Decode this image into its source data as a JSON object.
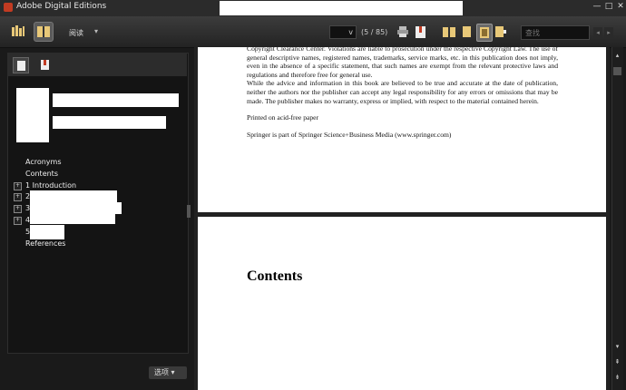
{
  "window": {
    "title": "Adobe Digital Editions",
    "minimize": "—",
    "maximize": "□",
    "close": "✕"
  },
  "toolbar": {
    "library_icon": "books-icon",
    "reading_icon": "open-book-icon",
    "read_label": "阅读",
    "read_caret": "▾",
    "page_select_value": "v",
    "page_count": "(5 / 85)",
    "search_placeholder": "查找",
    "prev": "◂",
    "next": "▸"
  },
  "left_panel": {
    "toc": [
      {
        "label": "Acronyms",
        "expandable": false
      },
      {
        "label": "Contents",
        "expandable": false
      },
      {
        "label": "1 Introduction",
        "expandable": true
      },
      {
        "label": "2",
        "expandable": true
      },
      {
        "label": "3",
        "expandable": true
      },
      {
        "label": "4",
        "expandable": true
      },
      {
        "label": "5",
        "expandable": false
      },
      {
        "label": "References",
        "expandable": false
      }
    ],
    "options_label": "选项 ▾"
  },
  "page1": {
    "para1": "Copyright Clearance Center. Violations are liable to prosecution under the respective Copyright Law. The use of general descriptive names, registered names, trademarks, service marks, etc. in this publication does not imply, even in the absence of a specific statement, that such names are exempt from the relevant protective laws and regulations and therefore free for general use.",
    "para2": "While the advice and information in this book are believed to be true and accurate at the date of publication, neither the authors nor the publisher can accept any legal responsibility for any errors or omissions that may be made. The publisher makes no warranty, express or implied, with respect to the material contained herein.",
    "para3": "Printed on acid-free paper",
    "para4": "Springer is part of Springer Science+Business Media (www.springer.com)"
  },
  "page2": {
    "heading": "Contents"
  },
  "colors": {
    "accent": "#e8c878",
    "background": "#1a1a1a",
    "panel": "#141414"
  }
}
